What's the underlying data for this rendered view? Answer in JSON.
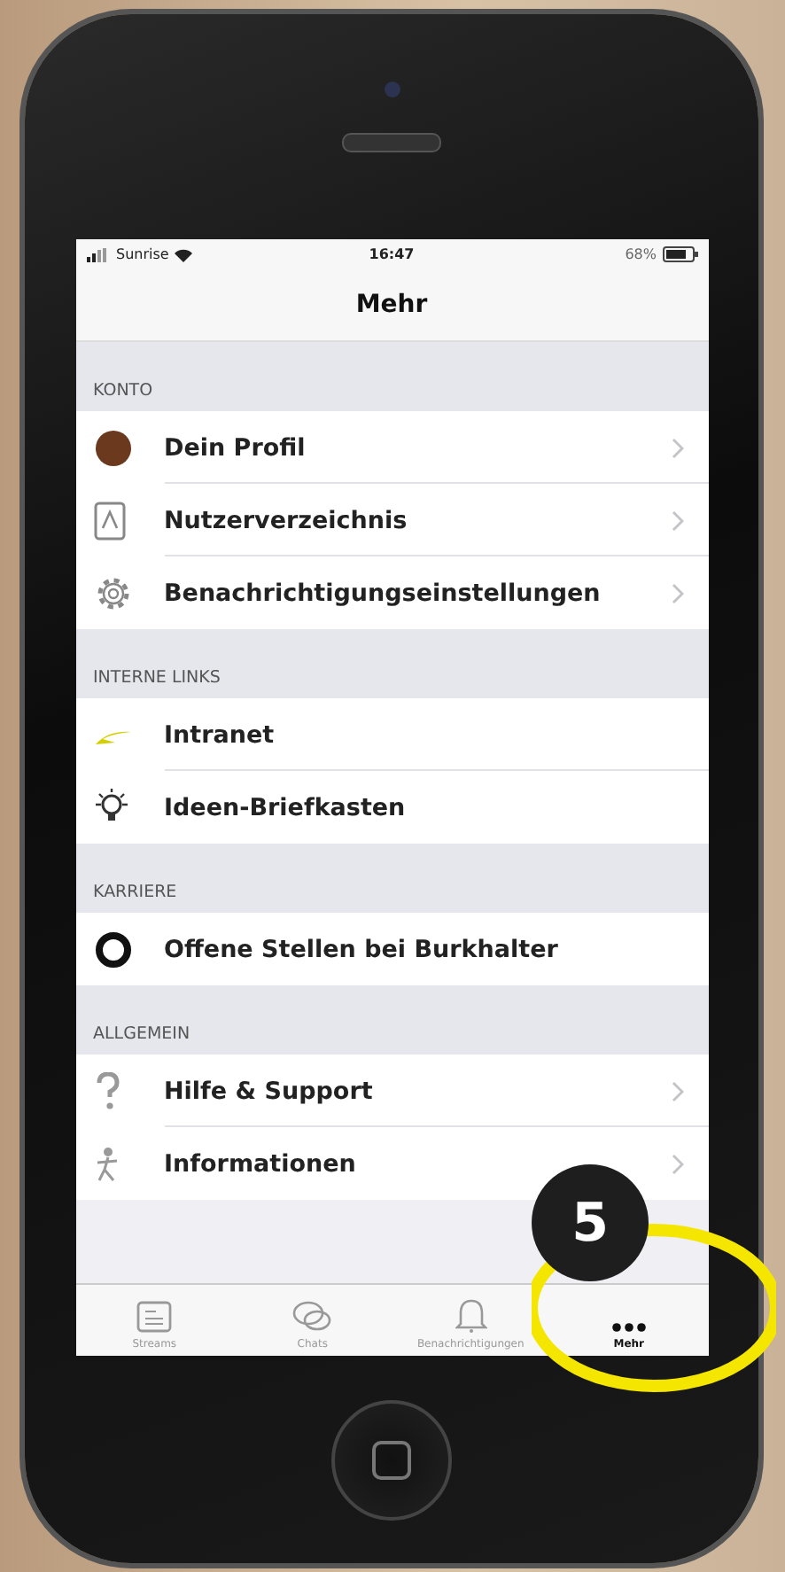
{
  "status_bar": {
    "carrier": "Sunrise",
    "time": "16:47",
    "battery": "68%"
  },
  "nav_bar": {
    "title": "Mehr"
  },
  "sections": [
    {
      "title": "KONTO",
      "items": [
        {
          "kind": "profile",
          "label": "Dein Profil",
          "chevron": true
        },
        {
          "kind": "directory",
          "label": "Nutzerverzeichnis",
          "chevron": true
        },
        {
          "kind": "settings",
          "label": "Benachrichtigungseinstellungen",
          "chevron": true
        }
      ]
    },
    {
      "title": "INTERNE LINKS",
      "items": [
        {
          "kind": "link",
          "label": "Intranet",
          "chevron": false
        },
        {
          "kind": "idea",
          "label": "Ideen-Briefkasten",
          "chevron": false
        }
      ]
    },
    {
      "title": "KARRIERE",
      "items": [
        {
          "kind": "jobs",
          "label": "Offene Stellen bei Burkhalter",
          "chevron": false
        }
      ]
    },
    {
      "title": "ALLGEMEIN",
      "items": [
        {
          "kind": "help",
          "label": "Hilfe & Support",
          "chevron": true
        },
        {
          "kind": "info",
          "label": "Informationen",
          "chevron": true
        }
      ]
    }
  ],
  "tab_bar": [
    {
      "kind": "streams",
      "label": "Streams",
      "selected": false
    },
    {
      "kind": "chats",
      "label": "Chats",
      "selected": false
    },
    {
      "kind": "bell",
      "label": "Benachrichtigungen",
      "selected": false
    },
    {
      "kind": "more",
      "label": "Mehr",
      "selected": true
    }
  ],
  "callout": {
    "number": "5"
  }
}
